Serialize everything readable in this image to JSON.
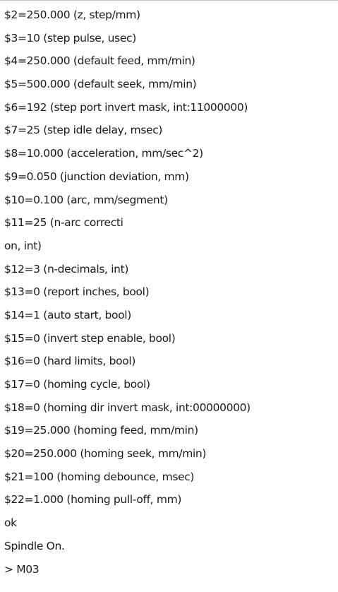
{
  "console": {
    "lines": [
      "$2=250.000 (z, step/mm)",
      "$3=10 (step pulse, usec)",
      "$4=250.000 (default feed, mm/min)",
      "$5=500.000 (default seek, mm/min)",
      "$6=192 (step port invert mask, int:11000000)",
      "$7=25 (step idle delay, msec)",
      "$8=10.000 (acceleration, mm/sec^2)",
      "$9=0.050 (junction deviation, mm)",
      "$10=0.100 (arc, mm/segment)",
      "$11=25 (n-arc correcti",
      "on, int)",
      "$12=3 (n-decimals, int)",
      "$13=0 (report inches, bool)",
      "$14=1 (auto start, bool)",
      "$15=0 (invert step enable, bool)",
      "$16=0 (hard limits, bool)",
      "$17=0 (homing cycle, bool)",
      "$18=0 (homing dir invert mask, int:00000000)",
      "$19=25.000 (homing feed, mm/min)",
      "$20=250.000 (homing seek, mm/min)",
      "$21=100 (homing debounce, msec)",
      "$22=1.000 (homing pull-off, mm)",
      "ok",
      "Spindle On.",
      "> M03"
    ]
  }
}
